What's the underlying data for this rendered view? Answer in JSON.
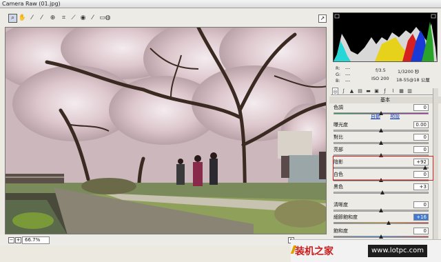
{
  "window": {
    "title": "Camera Raw (01.jpg)"
  },
  "toolbar": {
    "tools": [
      {
        "name": "zoom-tool",
        "icon": "zoom-icon"
      },
      {
        "name": "hand-tool",
        "icon": "hand-icon"
      },
      {
        "name": "white-balance-tool",
        "icon": "eyedropper-icon"
      },
      {
        "name": "color-sampler-tool",
        "icon": "color-sampler-icon"
      },
      {
        "name": "target-adjust-tool",
        "icon": "target-icon"
      },
      {
        "name": "crop-tool",
        "icon": "crop-icon"
      },
      {
        "name": "straighten-tool",
        "icon": "straighten-icon"
      },
      {
        "name": "redeye-tool",
        "icon": "redeye-icon"
      },
      {
        "name": "brush-tool",
        "icon": "brush-icon"
      },
      {
        "name": "graduated-filter-tool",
        "icon": "filter-icon"
      },
      {
        "name": "rotate-tool",
        "icon": "rotate-icon"
      }
    ]
  },
  "status": {
    "zoom": "66.7%"
  },
  "info": {
    "r_label": "R:",
    "r_val": "---",
    "g_label": "G:",
    "g_val": "---",
    "b_label": "B:",
    "b_val": "---",
    "aperture": "f/3.5",
    "shutter": "1/3200 秒",
    "iso": "ISO 200",
    "lens": "18-55@18 公厘"
  },
  "panel": {
    "section_title": "基本",
    "link_auto": "自動",
    "link_default": "預設",
    "rows": [
      {
        "label": "色調",
        "value": "0"
      },
      {
        "label": "曝光度",
        "value": "0.00"
      },
      {
        "label": "對比",
        "value": "0"
      },
      {
        "label": "亮部",
        "value": "0"
      },
      {
        "label": "陰影",
        "value": "+92"
      },
      {
        "label": "白色",
        "value": "0"
      },
      {
        "label": "黑色",
        "value": "+3"
      },
      {
        "label": "清晰度",
        "value": "0"
      },
      {
        "label": "細節飽和度",
        "value": "+16"
      },
      {
        "label": "飽和度",
        "value": "0"
      }
    ]
  },
  "watermark": {
    "brand": "装机之家",
    "url": "www.lotpc.com"
  }
}
